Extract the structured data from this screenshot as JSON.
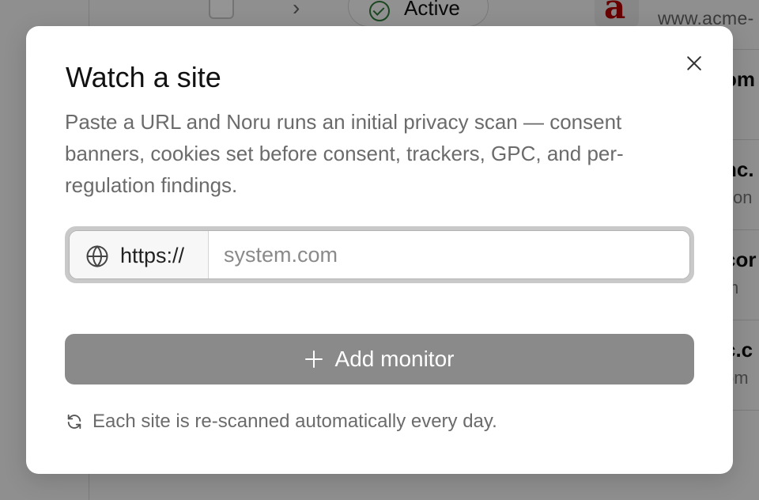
{
  "background": {
    "status_pill_label": "Active",
    "logo_letter": "a",
    "site_url": "www.acme-inc.com",
    "rows": [
      {
        "name": "om",
        "url": "n"
      },
      {
        "name": "nc.",
        "url": "con"
      },
      {
        "name": "cor",
        "url": "m"
      },
      {
        "name": "c.c",
        "url": "om"
      }
    ]
  },
  "modal": {
    "title": "Watch a site",
    "description": "Paste a URL and Noru runs an initial privacy scan — consent banners, cookies set before consent, trackers, GPC, and per-regulation findings.",
    "url_prefix": "https://",
    "url_placeholder": "system.com",
    "url_value": "",
    "add_button_label": "Add monitor",
    "footer_note": "Each site is re-scanned automatically every day.",
    "icons": {
      "close": "close-icon",
      "globe": "globe-icon",
      "plus": "plus-icon",
      "refresh": "refresh-icon"
    }
  },
  "colors": {
    "primary_button_disabled": "#8a8a8a",
    "active_status": "#2f7d3a",
    "logo_red": "#b30000"
  }
}
